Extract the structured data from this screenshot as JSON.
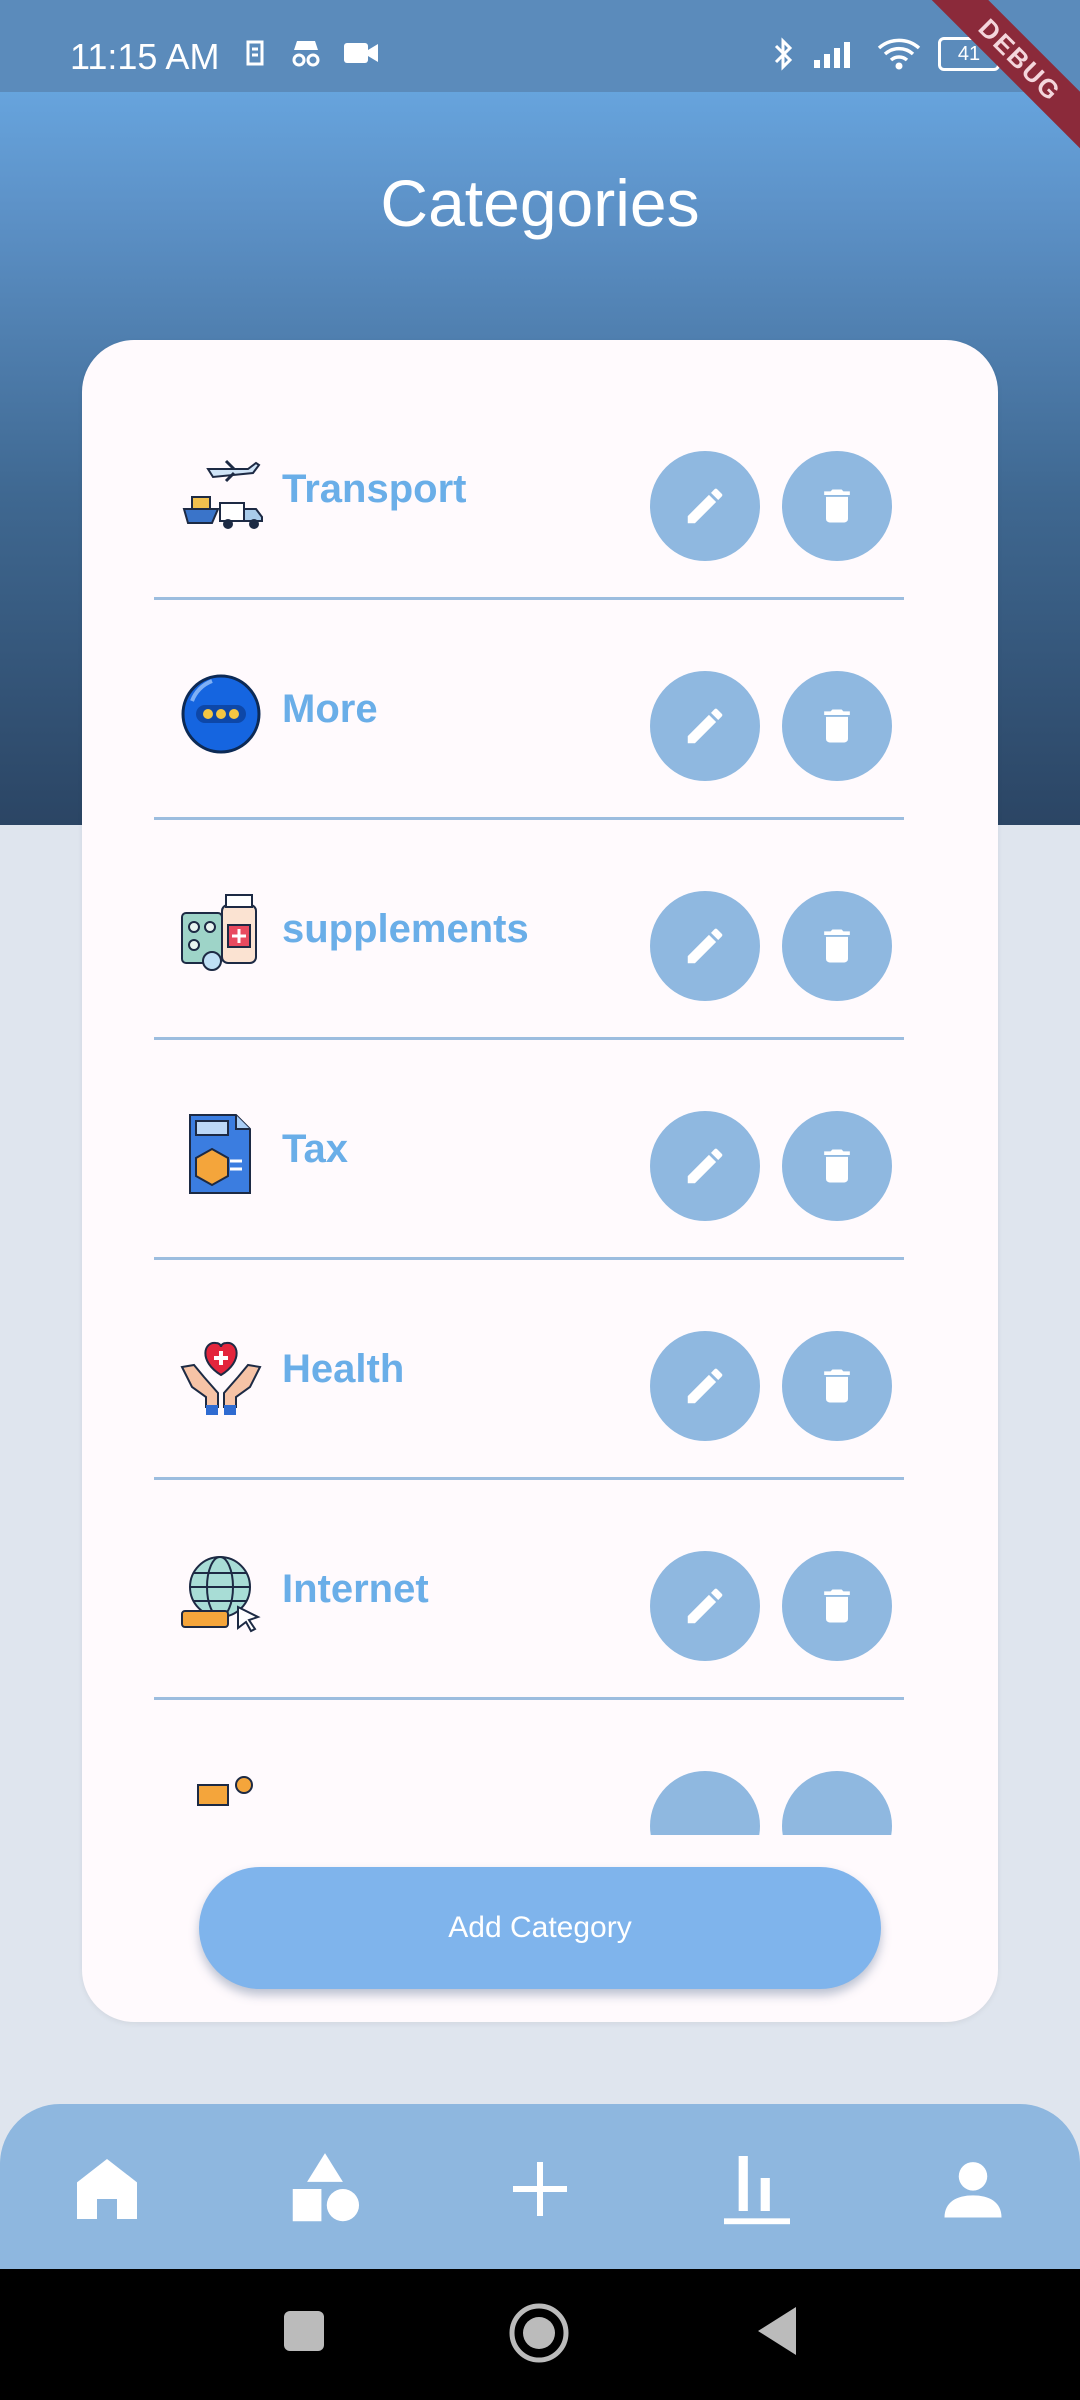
{
  "status_bar": {
    "time": "11:15 AM",
    "battery": "41",
    "left_icons": [
      "sim-icon",
      "incognito-icon",
      "video-icon"
    ],
    "right_icons": [
      "bluetooth-icon",
      "signal-icon",
      "wifi-icon",
      "battery-icon"
    ]
  },
  "debug_banner": "DEBUG",
  "page": {
    "title": "Categories"
  },
  "categories": [
    {
      "label": "Transport",
      "icon": "transport-icon"
    },
    {
      "label": "More",
      "icon": "more-icon"
    },
    {
      "label": "supplements",
      "icon": "supplements-icon"
    },
    {
      "label": "Tax",
      "icon": "tax-icon"
    },
    {
      "label": "Health",
      "icon": "health-icon"
    },
    {
      "label": "Internet",
      "icon": "internet-icon"
    },
    {
      "label": "",
      "icon": "partial-category-icon"
    }
  ],
  "row_actions": {
    "edit_icon": "pencil-icon",
    "delete_icon": "trash-icon"
  },
  "add_button": {
    "label": "Add Category"
  },
  "bottom_nav": {
    "items": [
      "home-icon",
      "categories-icon",
      "add-icon",
      "stats-icon",
      "profile-icon"
    ]
  },
  "system_nav": [
    "recents-button",
    "home-button",
    "back-button"
  ],
  "colors": {
    "accent": "#6aaee8",
    "button": "#8fb8e0",
    "add_button": "#7fb4ec",
    "nav": "#8eb7df"
  }
}
